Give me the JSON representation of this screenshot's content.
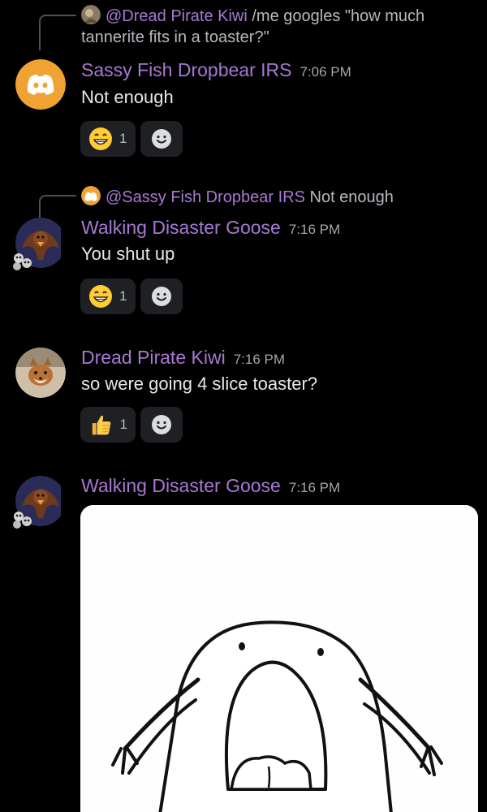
{
  "messages": [
    {
      "reply": {
        "mention": "@Dread Pirate Kiwi",
        "snippet_line1": "/me googles \"how much",
        "snippet_line2": "tannerite fits in a toaster?\""
      },
      "author": "Sassy Fish Dropbear IRS",
      "time": "7:06 PM",
      "text": "Not enough",
      "reaction": {
        "emoji": "grinning-face",
        "count": "1"
      }
    },
    {
      "reply": {
        "mention": "@Sassy Fish Dropbear IRS",
        "snippet": "Not enough"
      },
      "author": "Walking Disaster Goose",
      "time": "7:16 PM",
      "text": "You shut up",
      "reaction": {
        "emoji": "grinning-face",
        "count": "1"
      }
    },
    {
      "author": "Dread Pirate Kiwi",
      "time": "7:16 PM",
      "text": "so were going 4 slice toaster?",
      "reaction": {
        "emoji": "thumbs-up",
        "count": "1"
      }
    },
    {
      "author": "Walking Disaster Goose",
      "time": "7:16 PM",
      "attachment": "screaming-blob-drawing"
    }
  ],
  "colors": {
    "background": "#000000",
    "author": "#a679d4",
    "discord_orange": "#f0a232",
    "reaction_bg": "#1f2024"
  }
}
